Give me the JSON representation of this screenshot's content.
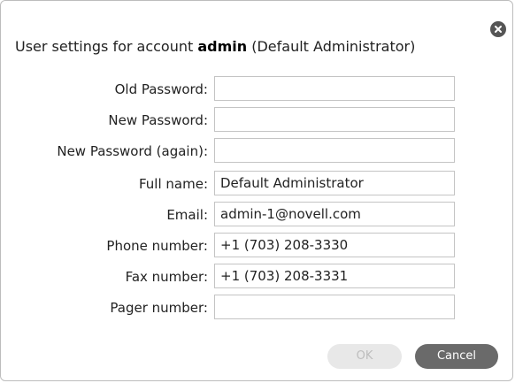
{
  "dialog": {
    "title_prefix": "User settings for account ",
    "account": "admin",
    "title_suffix": " (Default Administrator)",
    "close_icon": "close-icon"
  },
  "form": {
    "fields": [
      {
        "label": "Old Password:",
        "value": ""
      },
      {
        "label": "New Password:",
        "value": ""
      },
      {
        "label": "New Password (again):",
        "value": ""
      },
      {
        "label": "Full name:",
        "value": "Default Administrator"
      },
      {
        "label": "Email:",
        "value": "admin-1@novell.com"
      },
      {
        "label": "Phone number:",
        "value": "+1 (703) 208-3330"
      },
      {
        "label": "Fax number:",
        "value": "+1 (703) 208-3331"
      },
      {
        "label": "Pager number:",
        "value": ""
      }
    ]
  },
  "buttons": {
    "ok_label": "OK",
    "ok_enabled": false,
    "cancel_label": "Cancel"
  },
  "colors": {
    "cancel_button": "#6a6a6a",
    "ok_button_disabled": "#e8e8e8",
    "close_button": "#555555"
  }
}
